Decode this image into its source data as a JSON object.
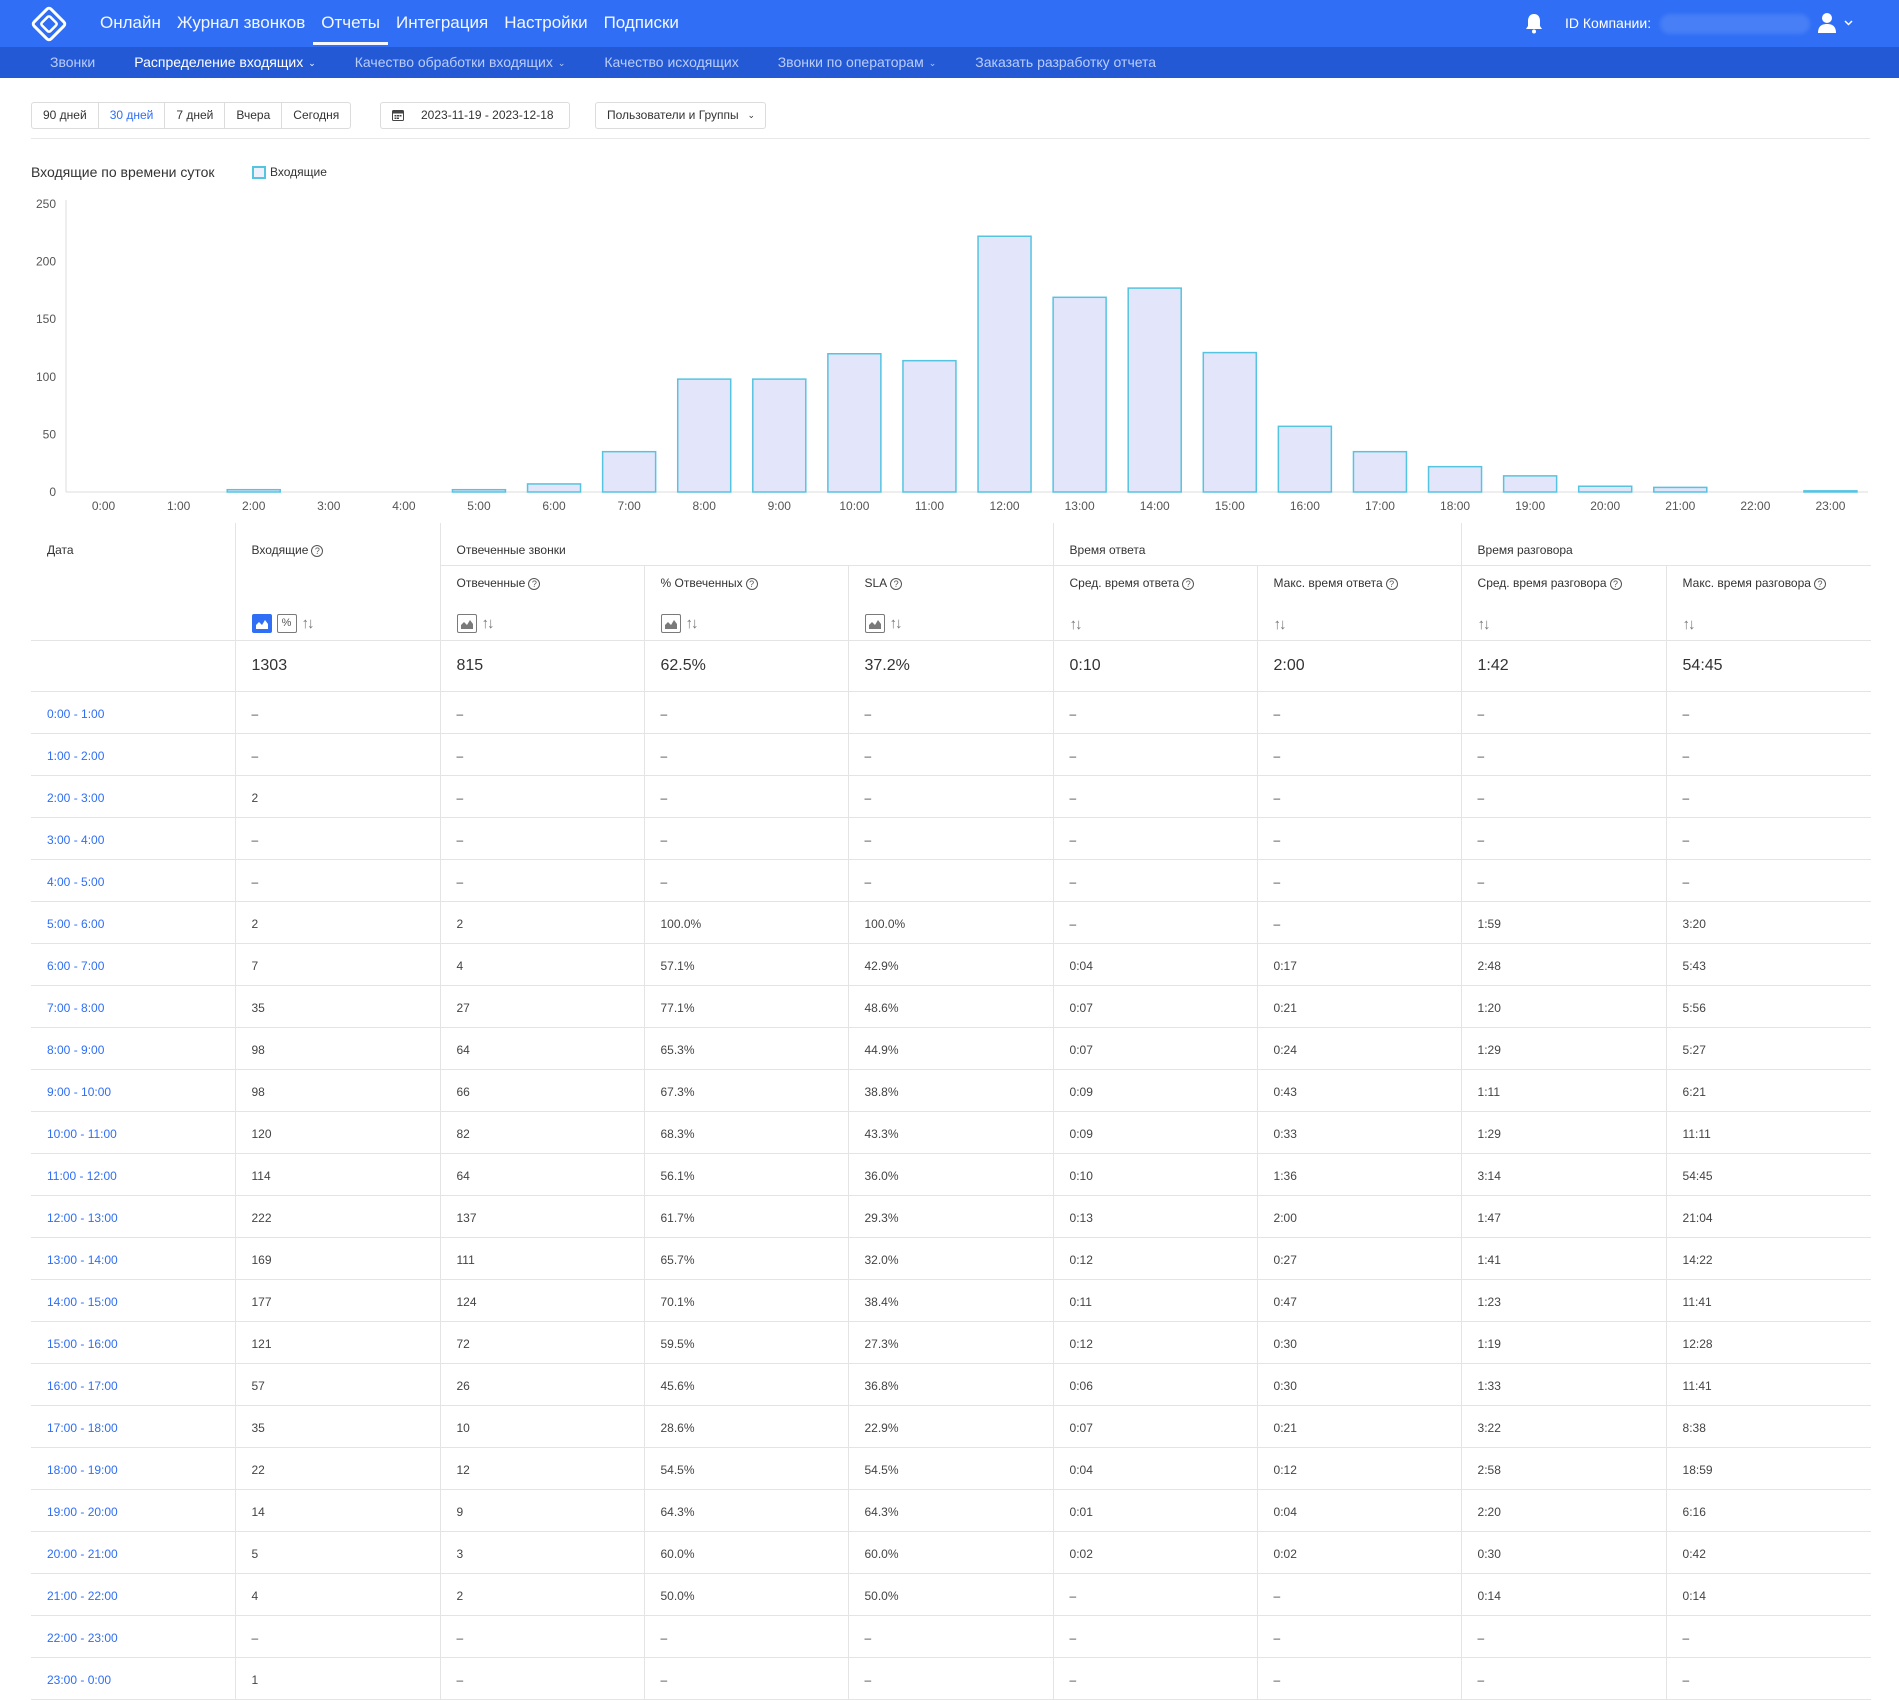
{
  "nav": {
    "items": [
      "Онлайн",
      "Журнал звонков",
      "Отчеты",
      "Интеграция",
      "Настройки",
      "Подписки"
    ],
    "active_index": 2,
    "company_label": "ID Компании:"
  },
  "subnav": {
    "items": [
      {
        "label": "Звонки",
        "dropdown": false
      },
      {
        "label": "Распределение входящих",
        "dropdown": true
      },
      {
        "label": "Качество обработки входящих",
        "dropdown": true
      },
      {
        "label": "Качество исходящих",
        "dropdown": false
      },
      {
        "label": "Звонки по операторам",
        "dropdown": true
      },
      {
        "label": "Заказать разработку отчета",
        "dropdown": false
      }
    ],
    "active_index": 1
  },
  "filters": {
    "periods": [
      "90 дней",
      "30 дней",
      "7 дней",
      "Вчера",
      "Сегодня"
    ],
    "active_period_index": 1,
    "date_range": "2023-11-19 - 2023-12-18",
    "users_dropdown": "Пользователи и Группы"
  },
  "colors": {
    "accent": "#2f6ef5",
    "bar_fill": "#e3e6fb",
    "bar_stroke": "#55c4e0"
  },
  "chart_data": {
    "type": "bar",
    "title": "Входящие по времени суток",
    "legend": [
      "Входящие"
    ],
    "categories": [
      "0:00",
      "1:00",
      "2:00",
      "3:00",
      "4:00",
      "5:00",
      "6:00",
      "7:00",
      "8:00",
      "9:00",
      "10:00",
      "11:00",
      "12:00",
      "13:00",
      "14:00",
      "15:00",
      "16:00",
      "17:00",
      "18:00",
      "19:00",
      "20:00",
      "21:00",
      "22:00",
      "23:00"
    ],
    "series": [
      {
        "name": "Входящие",
        "values": [
          0,
          0,
          2,
          0,
          0,
          2,
          7,
          35,
          98,
          98,
          120,
          114,
          222,
          169,
          177,
          121,
          57,
          35,
          22,
          14,
          5,
          4,
          0,
          1
        ]
      }
    ],
    "ylim": [
      0,
      250
    ],
    "yticks": [
      0,
      50,
      100,
      150,
      200,
      250
    ],
    "xlabel": "",
    "ylabel": ""
  },
  "table": {
    "group_headers": [
      "Дата",
      "Входящие",
      "Отвеченные звонки",
      "Время ответа",
      "Время разговора"
    ],
    "sub_headers": [
      "Отвеченные",
      "% Отвеченных",
      "SLA",
      "Сред. время ответа",
      "Макс. время ответа",
      "Сред. время разговора",
      "Макс. время разговора"
    ],
    "totals": [
      "",
      "1303",
      "815",
      "62.5%",
      "37.2%",
      "0:10",
      "2:00",
      "1:42",
      "54:45"
    ],
    "rows": [
      [
        "0:00 - 1:00",
        "–",
        "–",
        "–",
        "–",
        "–",
        "–",
        "–",
        "–"
      ],
      [
        "1:00 - 2:00",
        "–",
        "–",
        "–",
        "–",
        "–",
        "–",
        "–",
        "–"
      ],
      [
        "2:00 - 3:00",
        "2",
        "–",
        "–",
        "–",
        "–",
        "–",
        "–",
        "–"
      ],
      [
        "3:00 - 4:00",
        "–",
        "–",
        "–",
        "–",
        "–",
        "–",
        "–",
        "–"
      ],
      [
        "4:00 - 5:00",
        "–",
        "–",
        "–",
        "–",
        "–",
        "–",
        "–",
        "–"
      ],
      [
        "5:00 - 6:00",
        "2",
        "2",
        "100.0%",
        "100.0%",
        "–",
        "–",
        "1:59",
        "3:20"
      ],
      [
        "6:00 - 7:00",
        "7",
        "4",
        "57.1%",
        "42.9%",
        "0:04",
        "0:17",
        "2:48",
        "5:43"
      ],
      [
        "7:00 - 8:00",
        "35",
        "27",
        "77.1%",
        "48.6%",
        "0:07",
        "0:21",
        "1:20",
        "5:56"
      ],
      [
        "8:00 - 9:00",
        "98",
        "64",
        "65.3%",
        "44.9%",
        "0:07",
        "0:24",
        "1:29",
        "5:27"
      ],
      [
        "9:00 - 10:00",
        "98",
        "66",
        "67.3%",
        "38.8%",
        "0:09",
        "0:43",
        "1:11",
        "6:21"
      ],
      [
        "10:00 - 11:00",
        "120",
        "82",
        "68.3%",
        "43.3%",
        "0:09",
        "0:33",
        "1:29",
        "11:11"
      ],
      [
        "11:00 - 12:00",
        "114",
        "64",
        "56.1%",
        "36.0%",
        "0:10",
        "1:36",
        "3:14",
        "54:45"
      ],
      [
        "12:00 - 13:00",
        "222",
        "137",
        "61.7%",
        "29.3%",
        "0:13",
        "2:00",
        "1:47",
        "21:04"
      ],
      [
        "13:00 - 14:00",
        "169",
        "111",
        "65.7%",
        "32.0%",
        "0:12",
        "0:27",
        "1:41",
        "14:22"
      ],
      [
        "14:00 - 15:00",
        "177",
        "124",
        "70.1%",
        "38.4%",
        "0:11",
        "0:47",
        "1:23",
        "11:41"
      ],
      [
        "15:00 - 16:00",
        "121",
        "72",
        "59.5%",
        "27.3%",
        "0:12",
        "0:30",
        "1:19",
        "12:28"
      ],
      [
        "16:00 - 17:00",
        "57",
        "26",
        "45.6%",
        "36.8%",
        "0:06",
        "0:30",
        "1:33",
        "11:41"
      ],
      [
        "17:00 - 18:00",
        "35",
        "10",
        "28.6%",
        "22.9%",
        "0:07",
        "0:21",
        "3:22",
        "8:38"
      ],
      [
        "18:00 - 19:00",
        "22",
        "12",
        "54.5%",
        "54.5%",
        "0:04",
        "0:12",
        "2:58",
        "18:59"
      ],
      [
        "19:00 - 20:00",
        "14",
        "9",
        "64.3%",
        "64.3%",
        "0:01",
        "0:04",
        "2:20",
        "6:16"
      ],
      [
        "20:00 - 21:00",
        "5",
        "3",
        "60.0%",
        "60.0%",
        "0:02",
        "0:02",
        "0:30",
        "0:42"
      ],
      [
        "21:00 - 22:00",
        "4",
        "2",
        "50.0%",
        "50.0%",
        "–",
        "–",
        "0:14",
        "0:14"
      ],
      [
        "22:00 - 23:00",
        "–",
        "–",
        "–",
        "–",
        "–",
        "–",
        "–",
        "–"
      ],
      [
        "23:00 - 0:00",
        "1",
        "–",
        "–",
        "–",
        "–",
        "–",
        "–",
        "–"
      ]
    ]
  }
}
